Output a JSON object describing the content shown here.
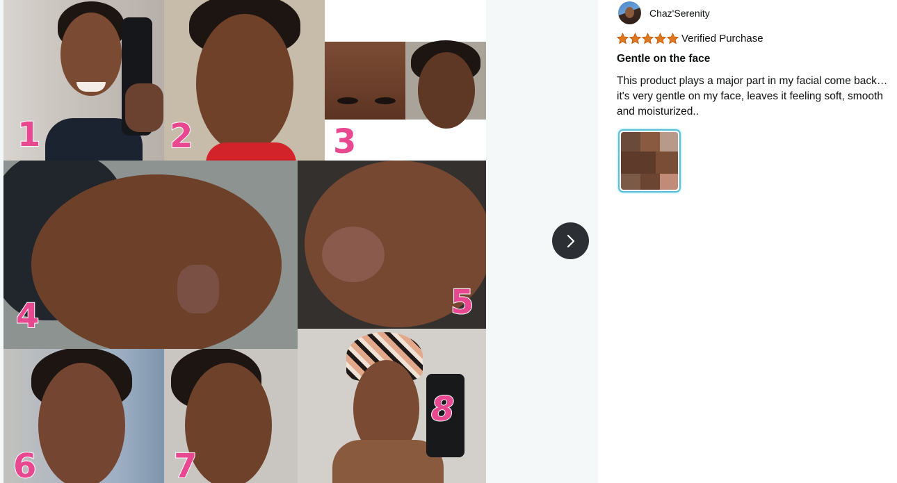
{
  "viewer": {
    "image_alt": "Customer review photo collage",
    "tile_numbers": [
      "1",
      "2",
      "3",
      "4",
      "5",
      "6",
      "7",
      "8"
    ],
    "next_icon": "chevron-right-icon"
  },
  "review": {
    "author": "Chaz'Serenity",
    "rating": 5,
    "rating_max": 5,
    "star_color": "#de7921",
    "verified": "Verified Purchase",
    "title": "Gentle on the face",
    "body": "This product plays a major part in my facial come back… it's very gentle on my face, leaves it feeling soft, smooth and moisturized..",
    "thumbnail_selected": true
  },
  "colors": {
    "accent_thumb_border": "#56c0d8",
    "next_button_bg": "#2c2f33"
  }
}
